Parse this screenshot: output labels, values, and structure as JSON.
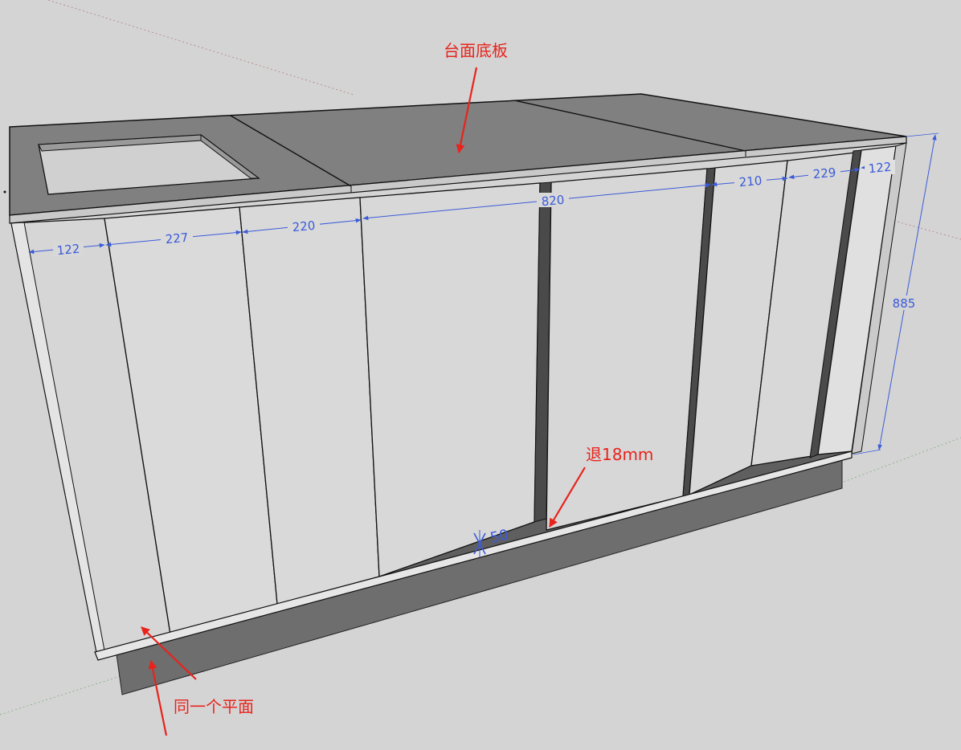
{
  "annotations": {
    "top_board": "台面底板",
    "setback": "退18mm",
    "same_plane": "同一个平面"
  },
  "dimensions": {
    "left_end_width": "122",
    "left_col_1": "227",
    "left_col_2": "220",
    "center_span": "820",
    "right_col_1": "210",
    "right_col_2": "229",
    "right_end_width": "122",
    "height": "885",
    "sketch_note": "50"
  },
  "colors": {
    "background": "#d4d4d4",
    "panel": "#d8d8d8",
    "countertop": "#808080",
    "plinth": "#6e6e6e",
    "dimension": "#3b5bd9",
    "annotation": "#e8231c"
  }
}
